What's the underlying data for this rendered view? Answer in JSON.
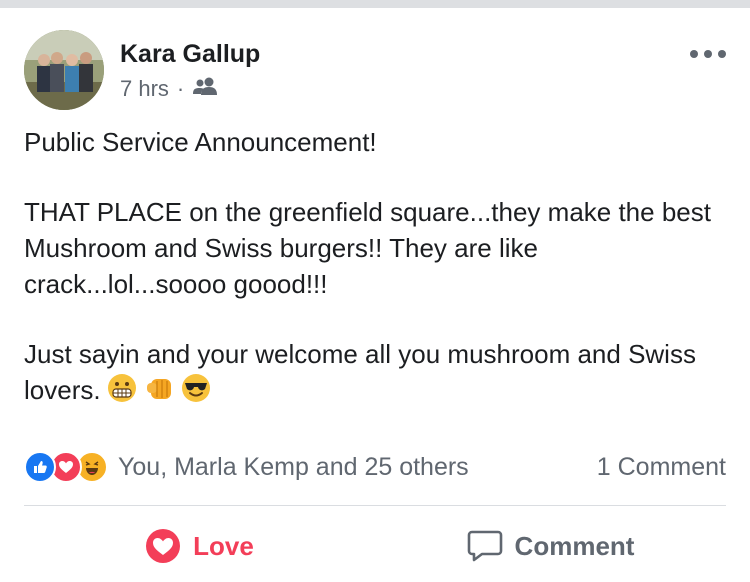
{
  "post": {
    "author": "Kara Gallup",
    "time": "7 hrs",
    "separator": "·",
    "audience_icon": "friends-icon",
    "paragraphs": [
      "Public Service Announcement!",
      "THAT PLACE on the greenfield square...they make the best Mushroom and Swiss burgers!!  They are like crack...lol...soooo goood!!!",
      "Just sayin and your welcome all you mushroom and Swiss lovers."
    ],
    "emojis": [
      "grimacing-face-icon",
      "fist-bump-icon",
      "sunglasses-face-icon"
    ]
  },
  "reactions": {
    "icons": [
      "like-icon",
      "love-icon",
      "haha-icon"
    ],
    "summary": "You, Marla Kemp and 25 others",
    "comments": "1 Comment"
  },
  "actions": {
    "love_label": "Love",
    "comment_label": "Comment"
  },
  "colors": {
    "like": "#1877f2",
    "love": "#f33e58",
    "haha": "#f7b125",
    "secondary_text": "#606770"
  }
}
